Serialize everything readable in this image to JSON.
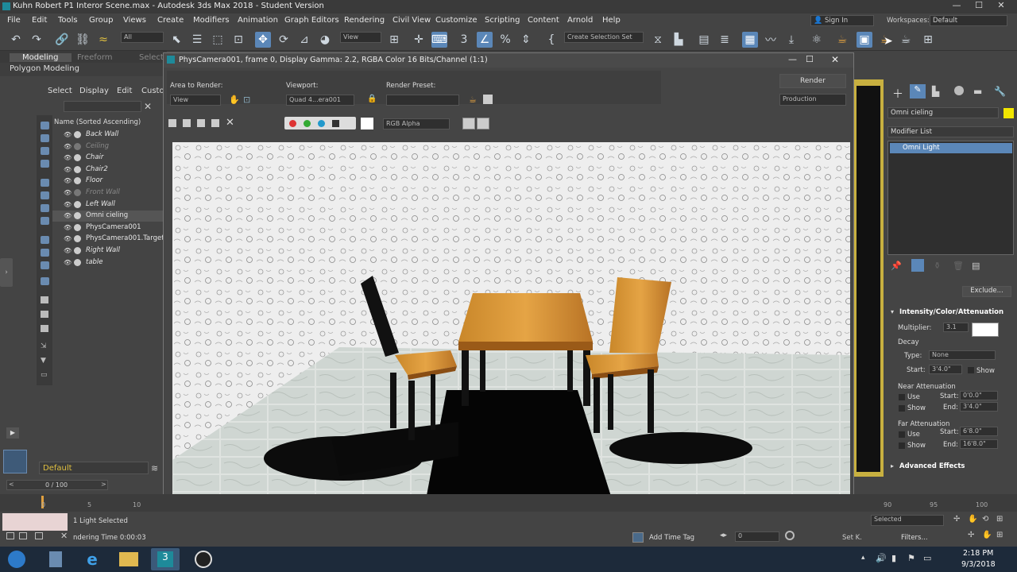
{
  "window": {
    "title": "Kuhn Robert P1 Interor Scene.max - Autodesk 3ds Max 2018 - Student Version"
  },
  "menu": [
    "File",
    "Edit",
    "Tools",
    "Group",
    "Views",
    "Create",
    "Modifiers",
    "Animation",
    "Graph Editors",
    "Rendering",
    "Civil View",
    "Customize",
    "Scripting",
    "Content",
    "Arnold",
    "Help"
  ],
  "signin": {
    "label": "Sign In"
  },
  "workspaces": {
    "label": "Workspaces:",
    "value": "Default"
  },
  "toolbar": {
    "filter_value": "All",
    "view_value": "View",
    "selection_set": "Create Selection Set"
  },
  "ribbon": {
    "tabs": [
      "Modeling",
      "Freeform",
      "Select"
    ],
    "subtitle": "Polygon Modeling"
  },
  "explorer": {
    "tabs": [
      "Select",
      "Display",
      "Edit",
      "Custo"
    ],
    "header": "Name (Sorted Ascending)",
    "items": [
      {
        "name": "Back Wall",
        "dim": false
      },
      {
        "name": "Ceiling",
        "dim": true
      },
      {
        "name": "Chair",
        "dim": false
      },
      {
        "name": "Chair2",
        "dim": false
      },
      {
        "name": "Floor",
        "dim": false
      },
      {
        "name": "Front Wall",
        "dim": true
      },
      {
        "name": "Left Wall",
        "dim": false
      },
      {
        "name": "Omni cieling",
        "dim": false
      },
      {
        "name": "PhysCamera001",
        "dim": false
      },
      {
        "name": "PhysCamera001.Target",
        "dim": false
      },
      {
        "name": "Right Wall",
        "dim": false
      },
      {
        "name": "table",
        "dim": false
      }
    ],
    "layer": "Default",
    "frame_counter": "0 / 100"
  },
  "frame_buffer": {
    "title": "PhysCamera001, frame 0, Display Gamma: 2.2, RGBA Color 16 Bits/Channel (1:1)",
    "area_label": "Area to Render:",
    "area_value": "View",
    "viewport_label": "Viewport:",
    "viewport_value": "Quad 4...era001",
    "preset_label": "Render Preset:",
    "preset_value": "",
    "render_button": "Render",
    "production_value": "Production",
    "channel_value": "RGB Alpha"
  },
  "modifier_panel": {
    "object_name": "Omni cieling",
    "color_swatch": "#f2e600",
    "modifier_list_label": "Modifier List",
    "stack_item": "Omni Light",
    "exclude_button": "Exclude...",
    "section_title": "Intensity/Color/Attenuation",
    "multiplier_label": "Multiplier:",
    "multiplier_value": "3.1",
    "decay_label": "Decay",
    "type_label": "Type:",
    "type_value": "None",
    "start_label": "Start:",
    "decay_start": "3'4.0\"",
    "show_label": "Show",
    "near_label": "Near Attenuation",
    "use_label": "Use",
    "near_start": "0'0.0\"",
    "end_label": "End:",
    "near_end": "3'4.0\"",
    "far_label": "Far Attenuation",
    "far_start": "6'8.0\"",
    "far_end": "16'8.0\"",
    "advanced": "Advanced Effects"
  },
  "timeline": {
    "ticks": [
      "0",
      "5",
      "10",
      "90",
      "95",
      "100"
    ]
  },
  "status": {
    "selected": "1 Light Selected",
    "render_time": "ndering Time  0:00:03",
    "add_time_tag": "Add Time Tag",
    "frame_value": "0",
    "selected_dd": "Selected",
    "set_key": "Set K.",
    "filters": "Filters..."
  },
  "taskbar": {
    "time": "2:18 PM",
    "date": "9/3/2018"
  }
}
